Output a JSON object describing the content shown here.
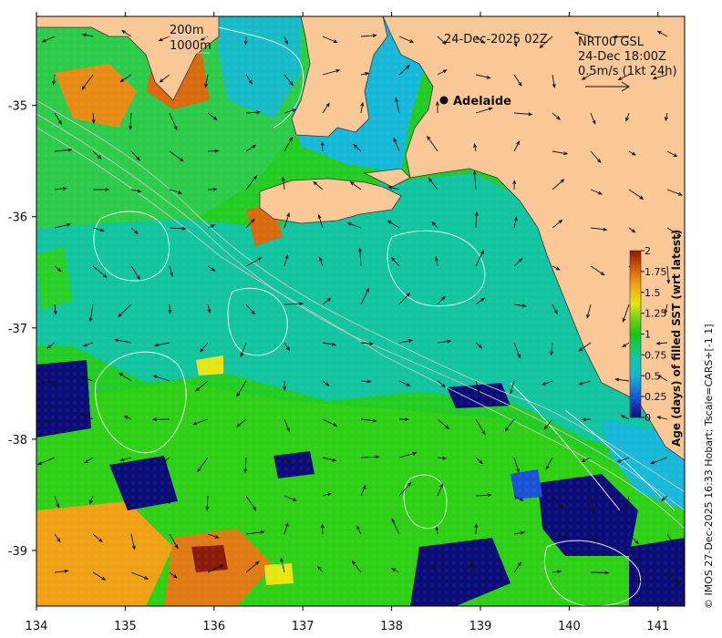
{
  "map": {
    "date_label": "24-Dec-2025 02Z",
    "product_lines": [
      "NRT00 GSL",
      "24-Dec 18:00Z",
      "0.5m/s (1kt 24h)"
    ],
    "contour_legend": [
      "200m",
      "1000m"
    ],
    "city": {
      "name": "Adelaide",
      "lon": 138.6,
      "lat": -34.93
    },
    "credit": "© IMOS 27-Dec-2025 16:33 Hobart; Tscale=CARS+[-1 1]",
    "x_ticks": [
      "134",
      "135",
      "136",
      "137",
      "138",
      "139",
      "140",
      "141"
    ],
    "y_ticks": [
      "-35",
      "-36",
      "-37",
      "-38",
      "-39"
    ],
    "extent": {
      "lon": [
        134,
        141.3
      ],
      "lat": [
        -39.5,
        -34.2
      ]
    }
  },
  "colorbar": {
    "title": "Age (days) of filled SST (wrt latest)",
    "ticks": [
      "2",
      "1.75",
      "1.5",
      "1.25",
      "1",
      "0.75",
      "0.5",
      "0.25",
      "0"
    ],
    "range": [
      0,
      2
    ],
    "colors": [
      "#0b0b7a",
      "#1a52d8",
      "#16b6d8",
      "#14c8a0",
      "#14c814",
      "#7ad414",
      "#e6e614",
      "#f0a014",
      "#d05a0a",
      "#8b1a0a"
    ]
  },
  "colors": {
    "land": "#fac896",
    "shelf_water": "#10c0a0",
    "gulf_water": "#12b8d8",
    "offshore_green": "#22cc22",
    "old_blue": "#0c0c78"
  }
}
